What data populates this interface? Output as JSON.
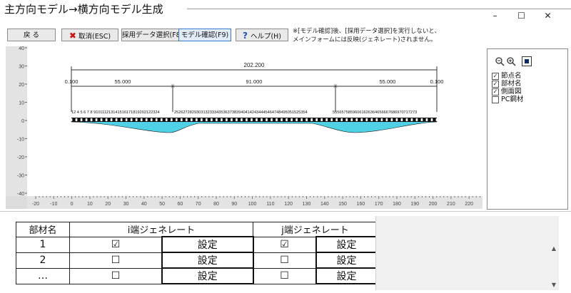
{
  "window": {
    "title": "主方向モデル→横方向モデル生成",
    "minimize": "–",
    "maximize": "☐",
    "close": "✕"
  },
  "toolbar": {
    "back": "戻 る",
    "cancel": "取消(ESC)",
    "select_data": "採用データ選択(F8)",
    "confirm_model": "モデル確認(F9)",
    "help": "ヘルプ(H)",
    "note_line1": "※[モデル確認]後、[採用データ選択]を実行しないと、",
    "note_line2": "メインフォームには反映(ジェネレート)されません。"
  },
  "plot": {
    "vertical_ticks": [
      "40",
      "30",
      "20",
      "10",
      "0",
      "-10",
      "-20",
      "-30",
      "-40"
    ],
    "horizontal_ticks": [
      "-20",
      "-10",
      "0",
      "10",
      "20",
      "30",
      "40",
      "50",
      "60",
      "70",
      "80",
      "90",
      "100",
      "110",
      "120",
      "130",
      "140",
      "150",
      "160",
      "170",
      "180",
      "190",
      "200",
      "210",
      "220"
    ],
    "total_length": "202.200",
    "spans": [
      "55.000",
      "91.000",
      "55.000"
    ],
    "end_left": "0.100",
    "end_right": "0.100",
    "node_labels_left": "12 4 5 6 7 8 910111213141516171819202122324",
    "node_labels_mid": "252627282930313233343536373839404142434445464748495051525354",
    "node_labels_right": "55565758596061626364656667686970717273"
  },
  "side_panel": {
    "zoom_out": "🔍-",
    "zoom_in": "🔍+",
    "fit": "■",
    "options": [
      {
        "label": "節点名",
        "checked": true
      },
      {
        "label": "部材名",
        "checked": true
      },
      {
        "label": "側面図",
        "checked": true
      },
      {
        "label": "PC鋼材",
        "checked": false
      }
    ]
  },
  "table": {
    "header": [
      "部材名",
      "i端ジェネレート",
      "j端ジェネレート"
    ],
    "rows": [
      {
        "name": "1",
        "i_check": "☑",
        "i_btn": "設定",
        "j_check": "☑",
        "j_btn": "設定"
      },
      {
        "name": "2",
        "i_check": "☐",
        "i_btn": "設定",
        "j_check": "☐",
        "j_btn": "設定"
      },
      {
        "name": "…",
        "i_check": "☐",
        "i_btn": "設定",
        "j_check": "☐",
        "j_btn": "設定"
      }
    ]
  },
  "colors": {
    "girder_fill": "#4fd1e6",
    "girder_outline": "#1a1a1a",
    "ruler_bg": "#e3e3e3",
    "canvas_bg": "#ffffff"
  }
}
